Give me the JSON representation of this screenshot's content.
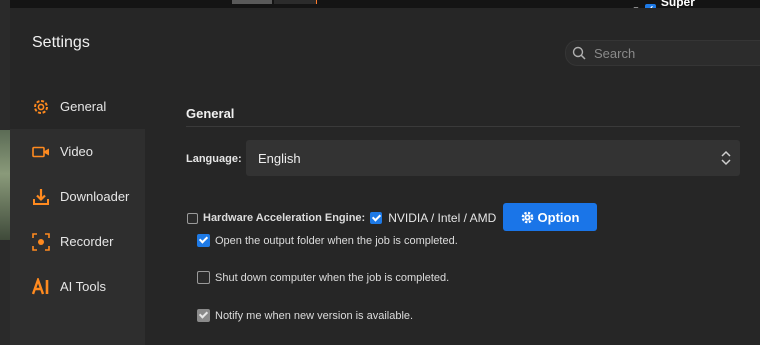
{
  "background": {
    "super_resolution_label": "Super Resolution"
  },
  "dialog": {
    "title": "Settings",
    "search_placeholder": "Search"
  },
  "sidebar": {
    "items": [
      {
        "label": "General",
        "icon": "gear-icon",
        "active": true
      },
      {
        "label": "Video",
        "icon": "video-camera-icon",
        "active": false
      },
      {
        "label": "Downloader",
        "icon": "download-icon",
        "active": false
      },
      {
        "label": "Recorder",
        "icon": "record-icon",
        "active": false
      },
      {
        "label": "AI Tools",
        "icon": "ai-icon",
        "active": false
      }
    ]
  },
  "general": {
    "section_title": "General",
    "language_label": "Language:",
    "language_value": "English",
    "hw_accel_label": "Hardware Acceleration Engine:",
    "hw_accel_checked": false,
    "gpu_label": "NVIDIA / Intel / AMD",
    "gpu_checked": true,
    "option_button": "Option",
    "open_folder_label": "Open the output folder when the job is completed.",
    "open_folder_checked": true,
    "shutdown_label": "Shut down computer when the job is completed.",
    "shutdown_checked": false,
    "notify_label": "Notify me when new version is available.",
    "notify_checked": true
  },
  "colors": {
    "accent": "#1a75e8",
    "orange": "#ff8a1f",
    "dialog_bg": "#262626",
    "sidebar_bg": "#2e2e2e"
  }
}
